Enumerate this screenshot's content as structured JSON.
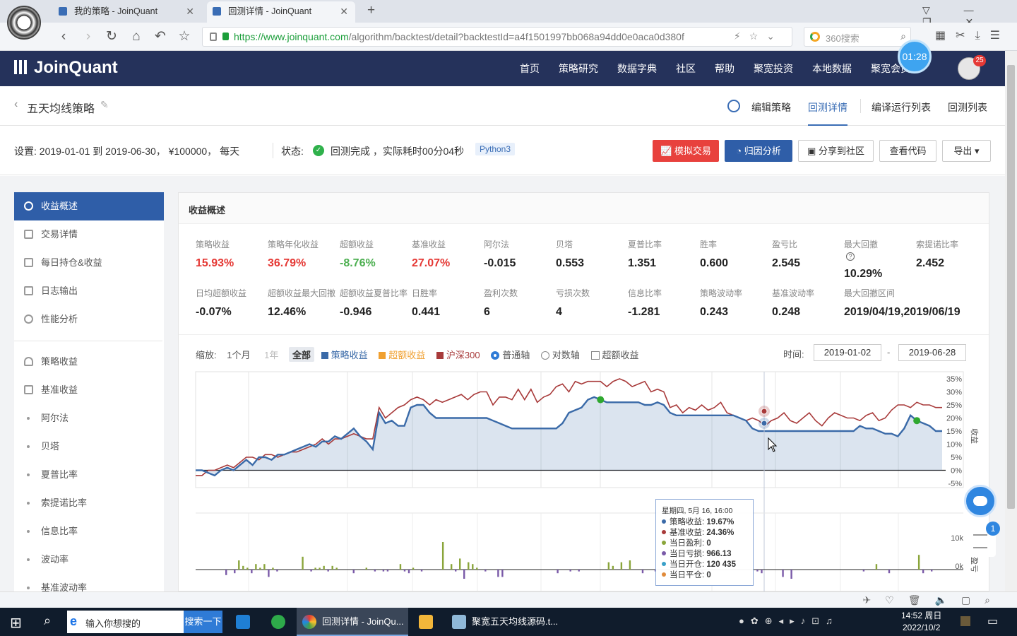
{
  "browser": {
    "tabs": [
      {
        "label": "我的策略 - JoinQuant",
        "active": false
      },
      {
        "label": "回测详情 - JoinQuant",
        "active": true
      }
    ],
    "url_base": "https://www.joinquant.com",
    "url_rest": "/algorithm/backtest/detail?backtestId=a4f1501997bb068a94dd0e0aca0d380f",
    "search_placeholder": "360搜索",
    "timer": "01:28"
  },
  "site": {
    "brand": "JoinQuant",
    "nav": [
      "首页",
      "策略研究",
      "数据字典",
      "社区",
      "帮助",
      "聚宽投资",
      "本地数据",
      "聚宽会员"
    ],
    "notif_count": "25"
  },
  "page": {
    "title": "五天均线策略",
    "subnav": [
      "编辑策略",
      "回测详情",
      "编译运行列表",
      "回测列表"
    ],
    "active_subnav": "回测详情"
  },
  "settings": {
    "text": "设置:   2019-01-01 到 2019-06-30，  ¥100000，   每天",
    "status_label": "状态:",
    "status_text": "回测完成 ，实际耗时00分04秒",
    "python": "Python3",
    "buttons": [
      "模拟交易",
      "归因分析",
      "分享到社区",
      "查看代码",
      "导出"
    ]
  },
  "sidebar": {
    "items": [
      {
        "label": "收益概述",
        "active": true
      },
      {
        "label": "交易详情"
      },
      {
        "label": "每日持仓&收益"
      },
      {
        "label": "日志输出"
      },
      {
        "label": "性能分析"
      },
      {
        "label": "策略收益"
      },
      {
        "label": "基准收益"
      },
      {
        "label": "阿尔法"
      },
      {
        "label": "贝塔"
      },
      {
        "label": "夏普比率"
      },
      {
        "label": "索提诺比率"
      },
      {
        "label": "信息比率"
      },
      {
        "label": "波动率"
      },
      {
        "label": "基准波动率"
      }
    ]
  },
  "panel": {
    "title": "收益概述",
    "metrics_row1": [
      {
        "label": "策略收益",
        "value": "15.93%",
        "color": "red"
      },
      {
        "label": "策略年化收益",
        "value": "36.79%",
        "color": "red"
      },
      {
        "label": "超额收益",
        "value": "-8.76%",
        "color": "green"
      },
      {
        "label": "基准收益",
        "value": "27.07%",
        "color": "red"
      },
      {
        "label": "阿尔法",
        "value": "-0.015",
        "color": ""
      },
      {
        "label": "贝塔",
        "value": "0.553",
        "color": ""
      },
      {
        "label": "夏普比率",
        "value": "1.351",
        "color": ""
      },
      {
        "label": "胜率",
        "value": "0.600",
        "color": ""
      },
      {
        "label": "盈亏比",
        "value": "2.545",
        "color": ""
      },
      {
        "label": "最大回撤",
        "value": "10.29%",
        "color": ""
      },
      {
        "label": "索提诺比率",
        "value": "2.452",
        "color": ""
      }
    ],
    "metrics_row2": [
      {
        "label": "日均超额收益",
        "value": "-0.07%"
      },
      {
        "label": "超额收益最大回撤",
        "value": "12.46%"
      },
      {
        "label": "超额收益夏普比率",
        "value": "-0.946"
      },
      {
        "label": "日胜率",
        "value": "0.441"
      },
      {
        "label": "盈利次数",
        "value": "6"
      },
      {
        "label": "亏损次数",
        "value": "4"
      },
      {
        "label": "信息比率",
        "value": "-1.281"
      },
      {
        "label": "策略波动率",
        "value": "0.243"
      },
      {
        "label": "基准波动率",
        "value": "0.248"
      },
      {
        "label": "最大回撤区间",
        "value": "2019/04/19,2019/06/19"
      }
    ],
    "controls": {
      "zoom_label": "缩放:",
      "zoom_options": [
        "1个月",
        "1年",
        "全部"
      ],
      "legend": [
        {
          "name": "策略收益",
          "color": "#3a6aa8"
        },
        {
          "name": "超额收益",
          "color": "#f0a030"
        },
        {
          "name": "沪深300",
          "color": "#a83a3a"
        }
      ],
      "axis_options": [
        "普通轴",
        "对数轴"
      ],
      "checkbox": "超额收益",
      "time_label": "时间:",
      "date_from": "2019-01-02",
      "date_to": "2019-06-28",
      "date_sep": "-"
    },
    "tooltip": {
      "header": "星期四, 5月 16, 16:00",
      "rows": [
        {
          "label": "策略收益:",
          "value": "19.67%",
          "color": "#3a6aa8"
        },
        {
          "label": "基准收益:",
          "value": "24.36%",
          "color": "#a83a3a"
        },
        {
          "label": "当日盈利:",
          "value": "0",
          "color": "#8aa53a"
        },
        {
          "label": "当日亏损:",
          "value": "966.13",
          "color": "#7a5aa8"
        },
        {
          "label": "当日开仓:",
          "value": "120 435",
          "color": "#3aa0c8"
        },
        {
          "label": "当日平仓:",
          "value": "0",
          "color": "#e08a3a"
        }
      ]
    }
  },
  "chart_data": {
    "type": "line",
    "ylim": [
      -5,
      35
    ],
    "yticks": [
      "35%",
      "30%",
      "25%",
      "20%",
      "15%",
      "10%",
      "5%",
      "0%",
      "-5%"
    ],
    "ylabel": "收益",
    "series": [
      {
        "name": "策略收益",
        "color": "#3a6aa8",
        "values": [
          0,
          0,
          -1,
          -2,
          0,
          1,
          0,
          2,
          4,
          2,
          5,
          5,
          4,
          6,
          6,
          7,
          8,
          9,
          10,
          9,
          11,
          11,
          13,
          12,
          14,
          16,
          13,
          11,
          8,
          22,
          18,
          19,
          17,
          17,
          24,
          25,
          25,
          22,
          20,
          20,
          20,
          20,
          20,
          20,
          20,
          20,
          20,
          19,
          18,
          17,
          16,
          16,
          16,
          16,
          16,
          16,
          16,
          16,
          18,
          22,
          23,
          24,
          27,
          28,
          27,
          26,
          26,
          26,
          26,
          26,
          26,
          25,
          25,
          26,
          25,
          22,
          21,
          21,
          21,
          21,
          21,
          21,
          21,
          21,
          21,
          21,
          20,
          19,
          16,
          15,
          15,
          15,
          15,
          15,
          15,
          15,
          15,
          15,
          15,
          15,
          15,
          15,
          15,
          15,
          15,
          17,
          16,
          16,
          15,
          14,
          14,
          13,
          16,
          21,
          19,
          18,
          17,
          15,
          15
        ]
      },
      {
        "name": "沪深300",
        "color": "#a83a3a",
        "values": [
          -2,
          -2,
          0,
          0,
          1,
          2,
          1,
          3,
          5,
          5,
          4,
          6,
          6,
          5,
          6,
          7,
          7,
          8,
          9,
          10,
          12,
          10,
          12,
          12,
          13,
          14,
          13,
          12,
          12,
          24,
          20,
          22,
          24,
          25,
          27,
          28,
          27,
          25,
          27,
          26,
          27,
          28,
          29,
          27,
          29,
          30,
          30,
          25,
          28,
          28,
          27,
          31,
          27,
          31,
          26,
          28,
          29,
          32,
          33,
          30,
          34,
          33,
          34,
          34,
          34,
          32,
          34,
          35,
          34,
          32,
          33,
          34,
          30,
          31,
          30,
          24,
          25,
          22,
          24,
          23,
          25,
          23,
          24,
          26,
          22,
          21,
          20,
          19,
          20,
          19,
          17,
          19,
          20,
          22,
          19,
          18,
          20,
          22,
          19,
          17,
          20,
          22,
          21,
          20,
          20,
          19,
          21,
          22,
          19,
          20,
          23,
          25,
          25,
          24,
          26,
          25,
          25,
          24,
          24
        ]
      }
    ],
    "markers": [
      {
        "series": "策略收益",
        "index": 64,
        "kind": "buy"
      },
      {
        "series": "策略收益",
        "index": 114,
        "kind": "buy"
      }
    ],
    "volume_yticks": [
      "10k",
      "0k"
    ],
    "volume_ylabel": "盈亏",
    "volume_values": [
      0,
      0,
      -3,
      0,
      -2,
      5,
      2,
      1,
      -2,
      3,
      1,
      3,
      -4,
      1,
      -1,
      0,
      0,
      0,
      0,
      0,
      7,
      0,
      -1,
      1,
      1,
      2,
      -1,
      2,
      1,
      0,
      0,
      0,
      -2,
      0,
      0,
      1,
      0,
      -1,
      0,
      -1,
      -1,
      0,
      0,
      3,
      -1,
      -2,
      1,
      0,
      -1,
      0,
      0,
      0,
      0,
      15,
      0,
      3,
      -1,
      6,
      -5,
      4,
      3,
      1,
      0,
      -1,
      0,
      0,
      -4,
      -4,
      0,
      0,
      0,
      0,
      0,
      0,
      0,
      0,
      0,
      0,
      0,
      0,
      -2,
      0,
      0,
      -1,
      0,
      -1,
      0,
      0,
      0,
      0,
      0,
      0,
      4,
      2,
      0,
      4,
      0,
      5,
      0,
      0,
      -2,
      0,
      0,
      -1,
      0,
      0,
      0,
      0,
      -2,
      0,
      0,
      0,
      0,
      0,
      -2,
      0,
      0,
      0,
      0,
      0,
      0,
      0,
      0,
      0,
      0,
      0,
      0,
      -1,
      -2,
      0,
      0,
      0,
      0,
      -4,
      0,
      -5,
      0,
      0,
      0,
      0,
      0,
      0,
      0,
      0,
      0,
      0,
      0,
      0,
      0,
      0,
      0,
      0,
      -1,
      0,
      0,
      3,
      0,
      0,
      -2,
      0,
      0,
      0,
      0,
      0,
      0,
      8,
      -2,
      0,
      -1,
      0
    ]
  },
  "taskbar": {
    "search_placeholder": "输入你想搜的",
    "search_button": "搜索一下",
    "apps": [
      "回测详情 - JoinQu...",
      "聚宽五天均线源码.t..."
    ],
    "time": "14:52 周日",
    "date": "2022/10/2"
  }
}
